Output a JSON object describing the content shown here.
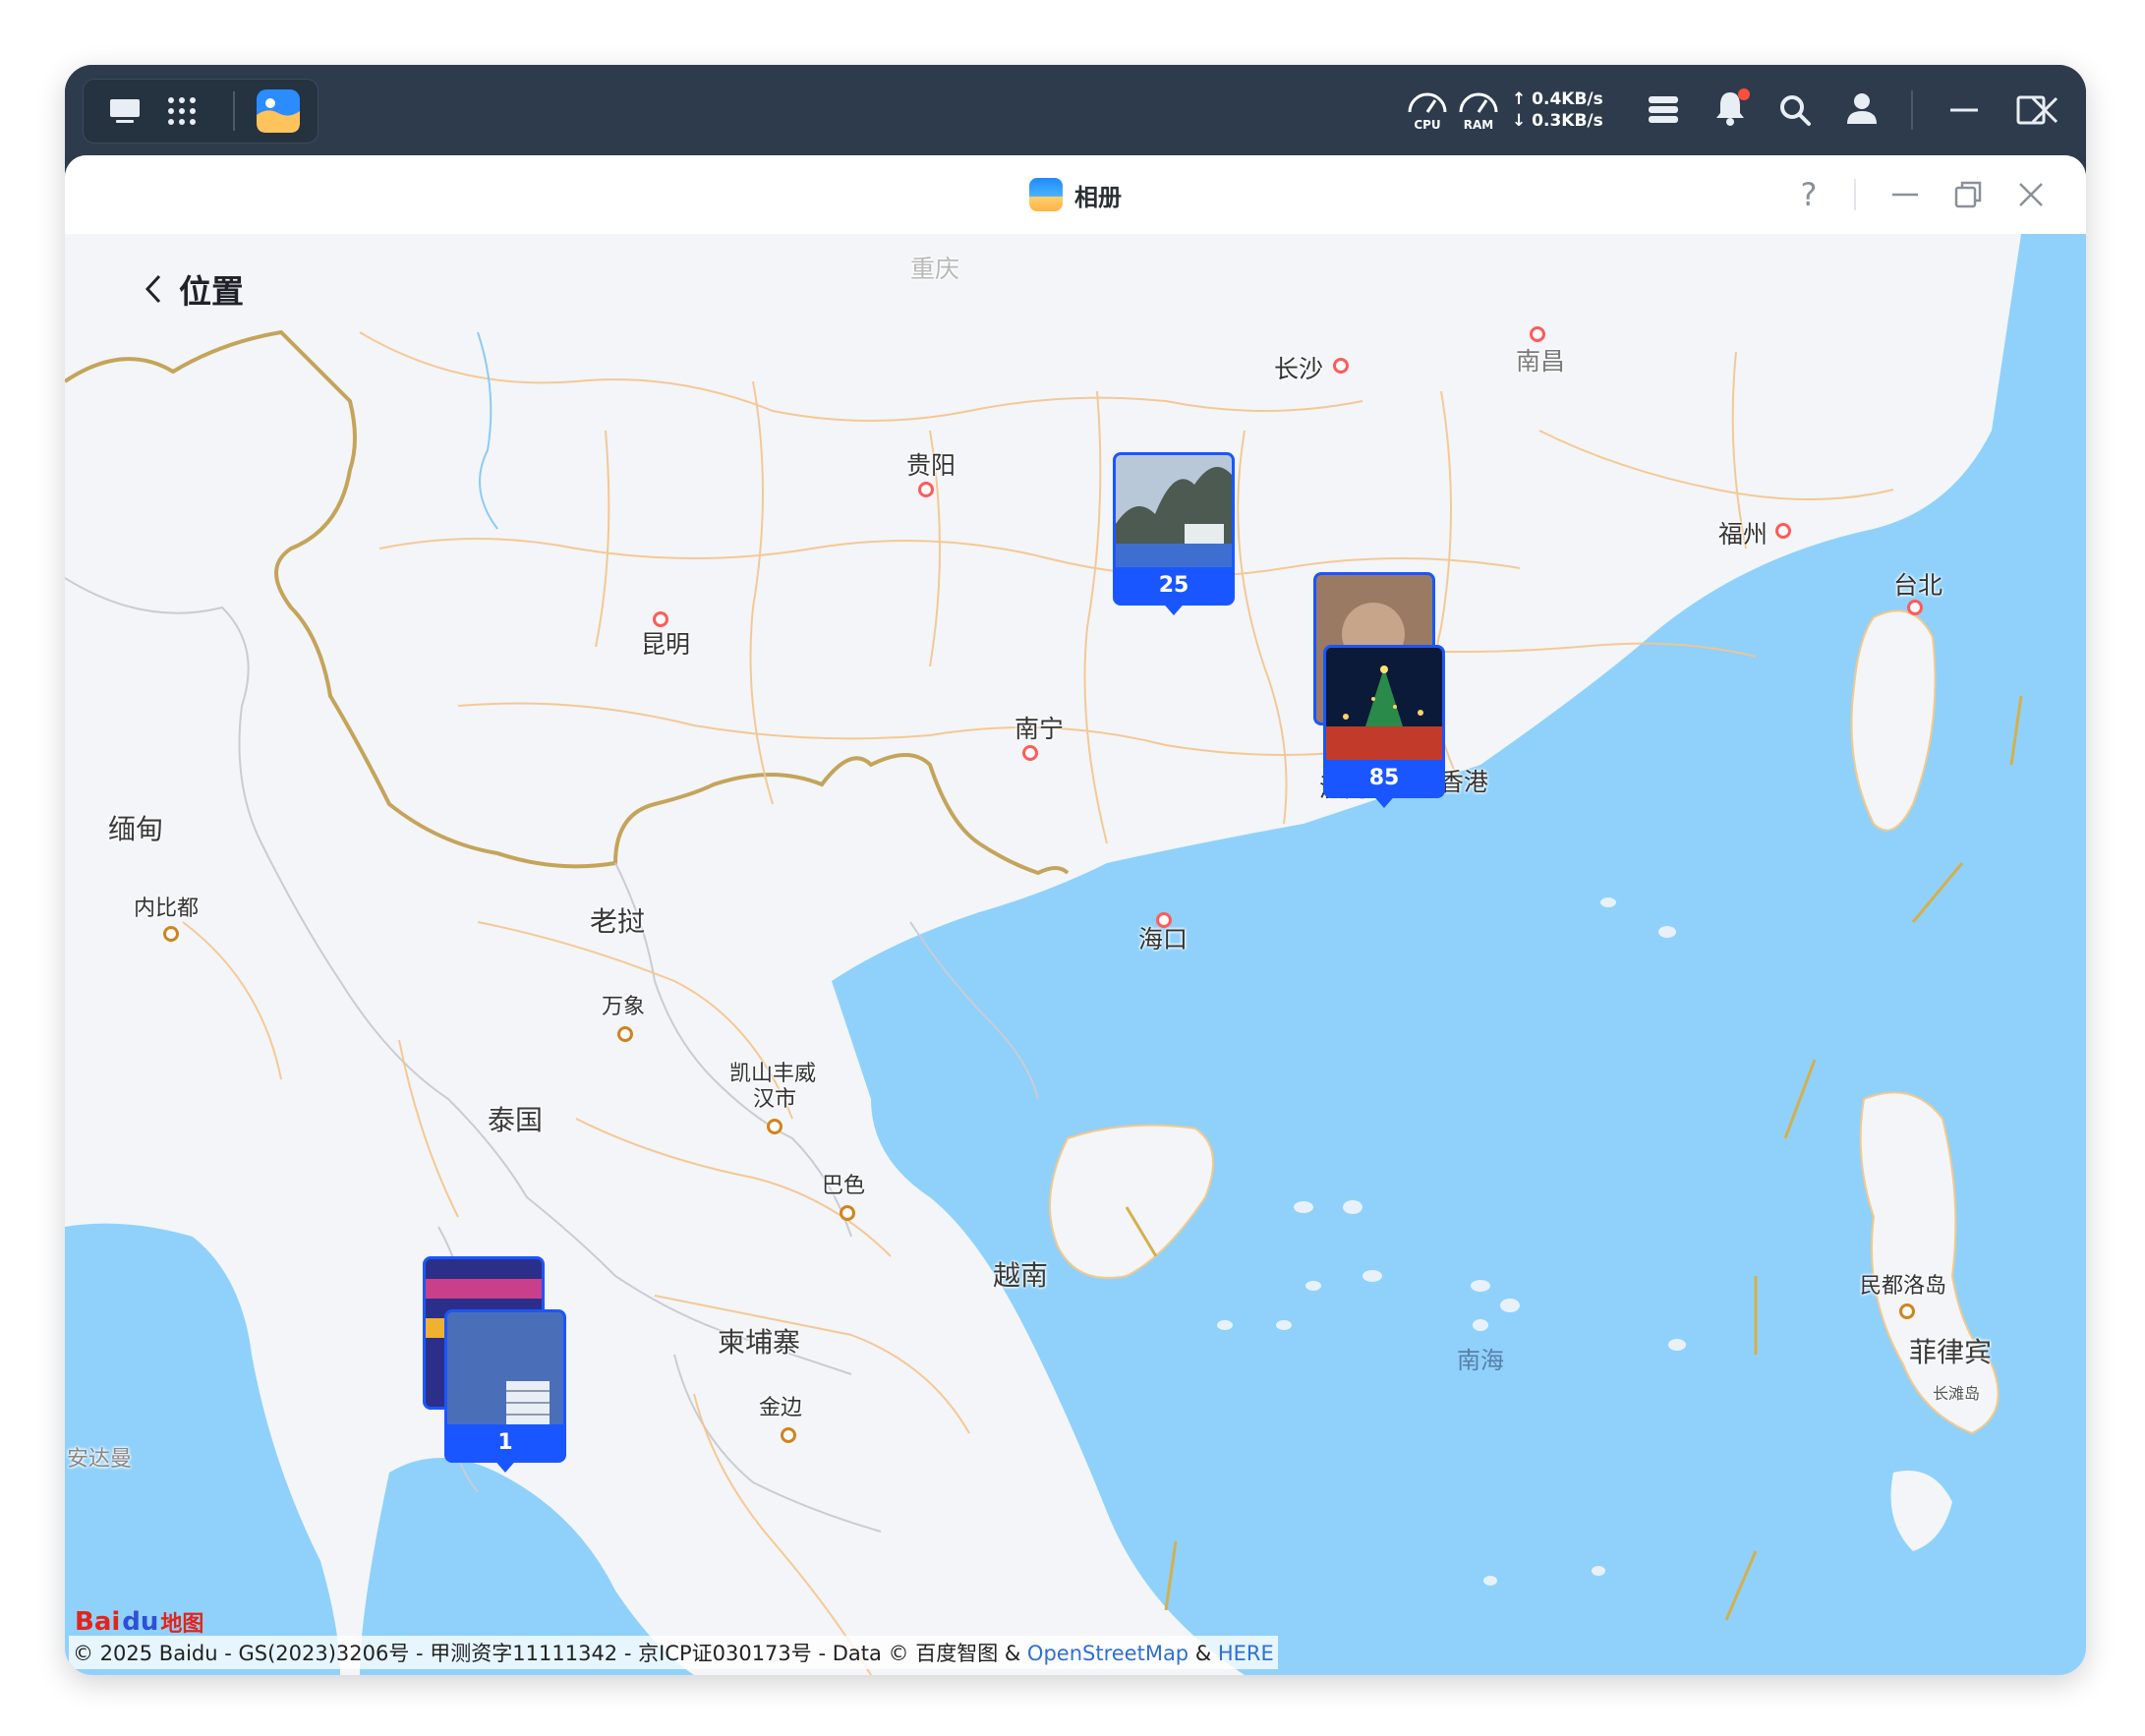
{
  "taskbar": {
    "cpu_label": "CPU",
    "ram_label": "RAM",
    "upload": "↑ 0.4KB/s",
    "download": "↓ 0.3KB/s"
  },
  "app": {
    "title": "相册",
    "help": "?"
  },
  "header": {
    "back_label": "位置"
  },
  "cities": [
    {
      "name": "重庆"
    },
    {
      "name": "长沙"
    },
    {
      "name": "南昌"
    },
    {
      "name": "贵阳"
    },
    {
      "name": "福州"
    },
    {
      "name": "台北"
    },
    {
      "name": "昆明"
    },
    {
      "name": "南宁"
    },
    {
      "name": "澳门"
    },
    {
      "name": "香港"
    },
    {
      "name": "缅甸"
    },
    {
      "name": "内比都"
    },
    {
      "name": "老挝"
    },
    {
      "name": "海口"
    },
    {
      "name": "万象"
    },
    {
      "name": "凯山丰威"
    },
    {
      "name": "汉市"
    },
    {
      "name": "泰国"
    },
    {
      "name": "巴色"
    },
    {
      "name": "越南"
    },
    {
      "name": "柬埔寨"
    },
    {
      "name": "金边"
    },
    {
      "name": "南海"
    },
    {
      "name": "民都洛岛"
    },
    {
      "name": "菲律宾"
    },
    {
      "name": "长滩岛"
    },
    {
      "name": "安达曼"
    }
  ],
  "pins": [
    {
      "count": "25"
    },
    {
      "count": "85"
    },
    {
      "count": "1"
    }
  ],
  "attribution": {
    "text": "© 2025 Baidu - GS(2023)3206号 - 甲测资字11111342 - 京ICP证030173号 - Data © 百度智图 & ",
    "osm": "OpenStreetMap",
    "amp": " & ",
    "here": "HERE"
  },
  "logo": {
    "bai": "Bai",
    "du": "du",
    "map": "地图"
  },
  "colors": {
    "accent": "#1a56ff",
    "sea": "#8fd1fb",
    "land": "#f3f5f8",
    "topbar": "#2d3b4c"
  }
}
